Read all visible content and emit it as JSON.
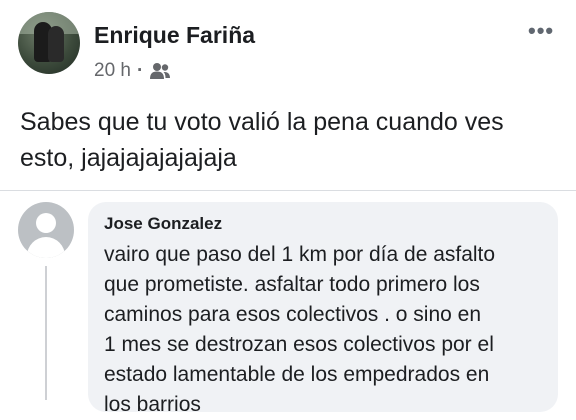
{
  "post": {
    "author": "Enrique Fariña",
    "time": "20 h",
    "separator": "·",
    "audience_icon": "friends-icon",
    "more_label": "•••",
    "text_line1": "Sabes que tu voto valió la pena cuando ves",
    "text_line2": "esto, jajajajajajajaja"
  },
  "comment": {
    "author": "Jose Gonzalez",
    "lines": [
      "vairo que paso del 1 km por día de asfalto",
      "que prometiste. asfaltar todo primero los",
      "caminos para esos colectivos . o sino en",
      "1 mes se destrozan esos colectivos por el",
      "estado lamentable de los empedrados en",
      "los barrios"
    ]
  }
}
